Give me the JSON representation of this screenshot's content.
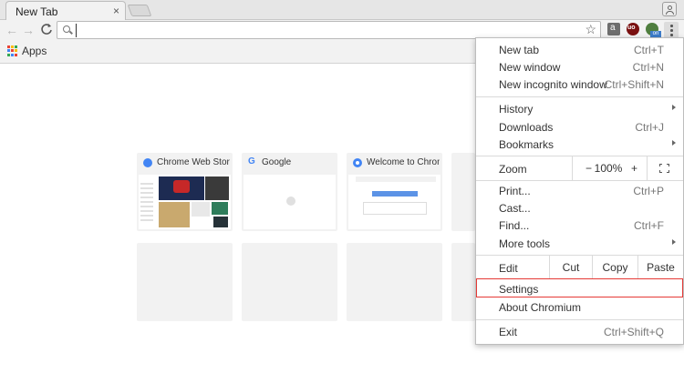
{
  "tab": {
    "title": "New Tab",
    "close": "×"
  },
  "toolbar": {
    "back": "←",
    "forward": "→",
    "reload": "C",
    "omnibox_value": "",
    "star": "☆"
  },
  "extensions": {
    "ext1": "a",
    "ext2": "uo",
    "ext3_badge": "on"
  },
  "bookmarks": {
    "apps_label": "Apps",
    "apps_colors": [
      "#ea4335",
      "#fbbc05",
      "#34a853",
      "#4285f4",
      "#ea4335",
      "#fbbc05",
      "#34a853",
      "#4285f4",
      "#ea4335"
    ]
  },
  "tiles": [
    {
      "title": "Chrome Web Store",
      "favicon": "chrome-web-store-icon"
    },
    {
      "title": "Google",
      "favicon": "google-icon"
    },
    {
      "title": "Welcome to Chrom",
      "favicon": "chromium-icon"
    }
  ],
  "menu": {
    "new_tab": {
      "label": "New tab",
      "shortcut": "Ctrl+T"
    },
    "new_window": {
      "label": "New window",
      "shortcut": "Ctrl+N"
    },
    "new_incognito": {
      "label": "New incognito window",
      "shortcut": "Ctrl+Shift+N"
    },
    "history": {
      "label": "History"
    },
    "downloads": {
      "label": "Downloads",
      "shortcut": "Ctrl+J"
    },
    "bookmarks": {
      "label": "Bookmarks"
    },
    "zoom": {
      "label": "Zoom",
      "minus": "−",
      "level": "100%",
      "plus": "+"
    },
    "print": {
      "label": "Print...",
      "shortcut": "Ctrl+P"
    },
    "cast": {
      "label": "Cast..."
    },
    "find": {
      "label": "Find...",
      "shortcut": "Ctrl+F"
    },
    "more_tools": {
      "label": "More tools"
    },
    "edit": {
      "label": "Edit",
      "cut": "Cut",
      "copy": "Copy",
      "paste": "Paste"
    },
    "settings": {
      "label": "Settings"
    },
    "about": {
      "label": "About Chromium"
    },
    "exit": {
      "label": "Exit",
      "shortcut": "Ctrl+Shift+Q"
    }
  }
}
